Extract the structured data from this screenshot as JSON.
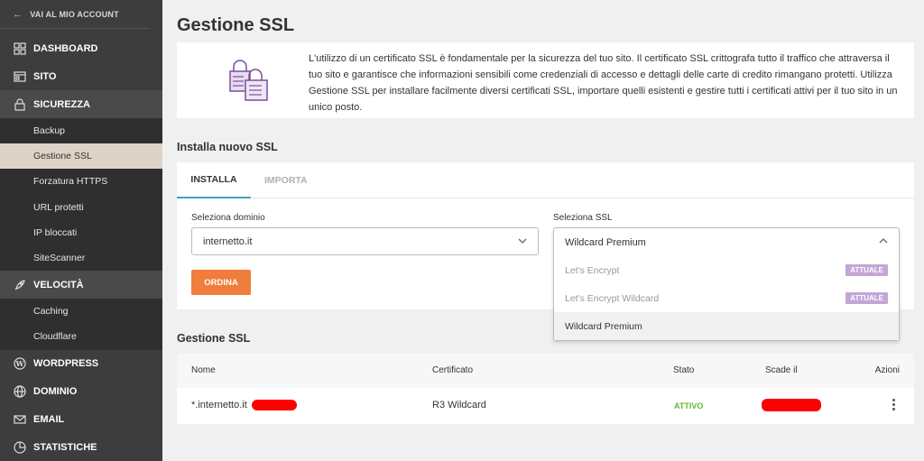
{
  "sidebar": {
    "back_label": "VAI AL MIO ACCOUNT",
    "items": [
      {
        "label": "DASHBOARD",
        "icon": "dashboard-icon"
      },
      {
        "label": "SITO",
        "icon": "site-icon"
      },
      {
        "label": "SICUREZZA",
        "icon": "lock-icon"
      }
    ],
    "security_sub": [
      "Backup",
      "Gestione SSL",
      "Forzatura HTTPS",
      "URL protetti",
      "IP bloccati",
      "SiteScanner"
    ],
    "speed_label": "VELOCITÀ",
    "speed_sub": [
      "Caching",
      "Cloudflare"
    ],
    "bottom_items": [
      {
        "label": "WORDPRESS",
        "icon": "wordpress-icon"
      },
      {
        "label": "DOMINIO",
        "icon": "globe-icon"
      },
      {
        "label": "EMAIL",
        "icon": "email-icon"
      },
      {
        "label": "STATISTICHE",
        "icon": "stats-icon"
      }
    ]
  },
  "page": {
    "title": "Gestione SSL",
    "info": "L'utilizzo di un certificato SSL è fondamentale per la sicurezza del tuo sito. Il certificato SSL crittografa tutto il traffico che attraversa il tuo sito e garantisce che informazioni sensibili come credenziali di accesso e dettagli delle carte di credito rimangano protetti. Utilizza Gestione SSL per installare facilmente diversi certificati SSL, importare quelli esistenti e gestire tutti i certificati attivi per il tuo sito in un unico posto."
  },
  "install": {
    "section_title": "Installa nuovo SSL",
    "tabs": [
      "INSTALLA",
      "IMPORTA"
    ],
    "domain_label": "Seleziona dominio",
    "domain_value": "internetto.it",
    "ssl_label": "Seleziona SSL",
    "ssl_value": "Wildcard Premium",
    "options": [
      {
        "label": "Let's Encrypt",
        "badge": "ATTUALE"
      },
      {
        "label": "Let's Encrypt Wildcard",
        "badge": "ATTUALE"
      },
      {
        "label": "Wildcard Premium",
        "badge": ""
      }
    ],
    "order_label": "ORDINA"
  },
  "manage": {
    "section_title": "Gestione SSL",
    "columns": [
      "Nome",
      "Certificato",
      "Stato",
      "Scade il",
      "Azioni"
    ],
    "row": {
      "name": "*.internetto.it",
      "certificate": "R3 Wildcard",
      "status": "ATTIVO"
    }
  },
  "colors": {
    "accent_orange": "#f07d3c",
    "tab_underline": "#3aa6b9",
    "status_green": "#5cb832",
    "badge_purple": "#c3a6d6"
  }
}
